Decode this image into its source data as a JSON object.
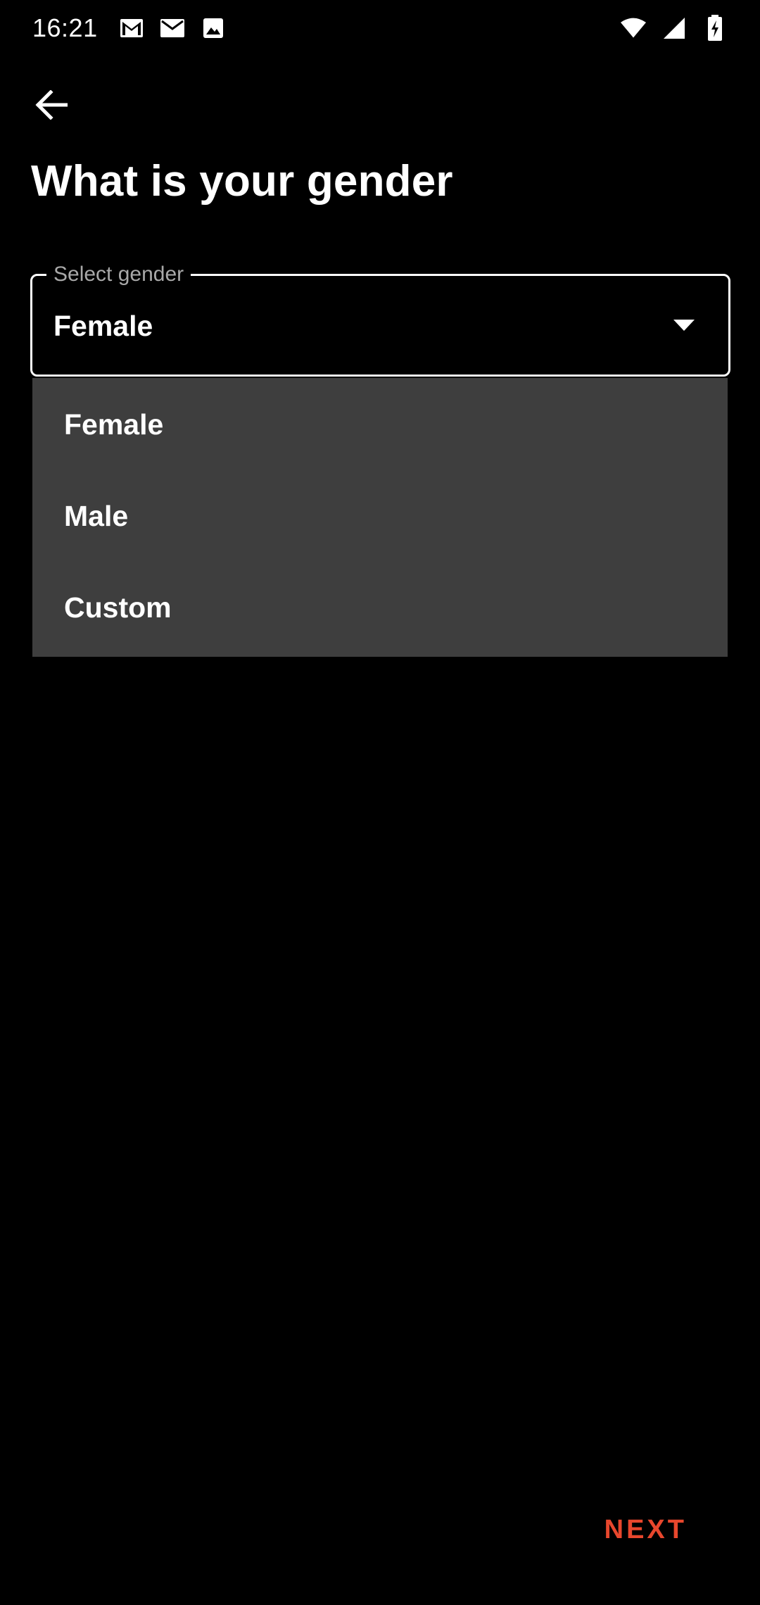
{
  "status_bar": {
    "time": "16:21",
    "left_icons": [
      "gmail-icon",
      "mail-icon",
      "image-icon"
    ],
    "right_icons": [
      "wifi-icon",
      "signal-icon",
      "battery-charging-icon"
    ]
  },
  "navigation": {
    "back_icon": "arrow-back-icon"
  },
  "page": {
    "title": "What is your gender"
  },
  "select": {
    "label": "Select gender",
    "value": "Female",
    "arrow_icon": "dropdown-arrow-icon",
    "options": [
      "Female",
      "Male",
      "Custom"
    ]
  },
  "footer": {
    "next_label": "NEXT"
  },
  "colors": {
    "background": "#000000",
    "menu_background": "#3e3e3e",
    "accent": "#e8472d",
    "label": "#a8a8a8"
  }
}
